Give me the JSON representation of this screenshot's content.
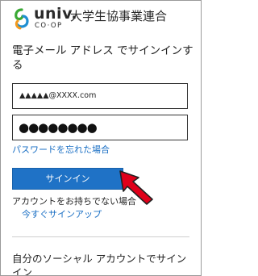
{
  "header": {
    "logo_univ": "univ.",
    "logo_coop": "CO·OP",
    "org_name": "大学生協事業連合"
  },
  "login": {
    "heading": "電子メール アドレス でサインインする",
    "email_value": "▲▲▲▲▲@XXXX.com",
    "password_mask": "●●●●●●●●",
    "forgot_password": "パスワードを忘れた場合",
    "signin_button": "サインイン",
    "no_account": "アカウントをお持ちでない場合",
    "signup_link": "今すぐサインアップ"
  },
  "social": {
    "heading": "自分のソーシャル アカウントでサインイン"
  },
  "colors": {
    "accent": "#1f72c6",
    "link": "#1a6fc4",
    "arrow": "#e0001a",
    "logo_green": "#3aa935",
    "logo_blue": "#1f8fd1",
    "logo_orange": "#f39a1e"
  }
}
